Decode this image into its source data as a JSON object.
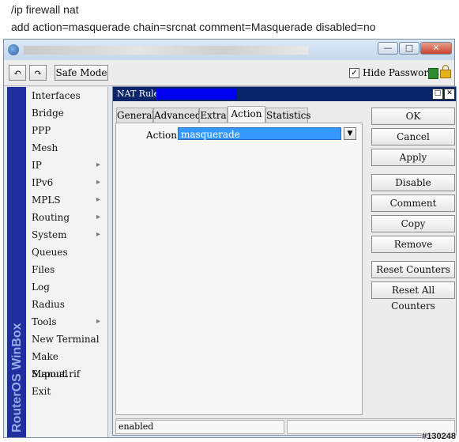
{
  "command": {
    "line1": "/ip firewall nat",
    "line2": "add action=masquerade chain=srcnat comment=Masquerade disabled=no"
  },
  "window": {
    "minimize_glyph": "—",
    "maximize_glyph": "□",
    "close_glyph": "✕"
  },
  "toolbar": {
    "undo_glyph": "↶",
    "redo_glyph": "↷",
    "safe_mode_label": "Safe Mode",
    "hide_passwords_label": "Hide Passwords",
    "hide_passwords_checked": true,
    "check_glyph": "✓"
  },
  "sidebar": {
    "brand": "RouterOS WinBox",
    "items": [
      {
        "label": "Interfaces",
        "arrow": ""
      },
      {
        "label": "Bridge",
        "arrow": ""
      },
      {
        "label": "PPP",
        "arrow": ""
      },
      {
        "label": "Mesh",
        "arrow": ""
      },
      {
        "label": "IP",
        "arrow": "▸"
      },
      {
        "label": "IPv6",
        "arrow": "▸"
      },
      {
        "label": "MPLS",
        "arrow": "▸"
      },
      {
        "label": "Routing",
        "arrow": "▸"
      },
      {
        "label": "System",
        "arrow": "▸"
      },
      {
        "label": "Queues",
        "arrow": ""
      },
      {
        "label": "Files",
        "arrow": ""
      },
      {
        "label": "Log",
        "arrow": ""
      },
      {
        "label": "Radius",
        "arrow": ""
      },
      {
        "label": "Tools",
        "arrow": "▸"
      },
      {
        "label": "New Terminal",
        "arrow": ""
      },
      {
        "label": "Make Supout.rif",
        "arrow": ""
      },
      {
        "label": "Manual",
        "arrow": ""
      },
      {
        "label": "Exit",
        "arrow": ""
      }
    ]
  },
  "dialog": {
    "title": "NAT Rule",
    "maximize_glyph": "□",
    "close_glyph": "✕",
    "tabs": [
      {
        "label": "General"
      },
      {
        "label": "Advanced"
      },
      {
        "label": "Extra"
      },
      {
        "label": "Action"
      },
      {
        "label": "Statistics"
      }
    ],
    "active_tab": "Action",
    "action_label": "Action:",
    "action_value": "masquerade",
    "dropdown_glyph": "▼",
    "buttons": {
      "ok": "OK",
      "cancel": "Cancel",
      "apply": "Apply",
      "disable": "Disable",
      "comment": "Comment",
      "copy": "Copy",
      "remove": "Remove",
      "reset_counters": "Reset Counters",
      "reset_all_counters": "Reset All Counters"
    },
    "status": "enabled"
  },
  "watermark": "#130248",
  "colors": {
    "sidebar_brand_bg": "#1f2fa0",
    "dialog_title_bg": "#0a246a",
    "selected_value_bg": "#3399ff"
  }
}
